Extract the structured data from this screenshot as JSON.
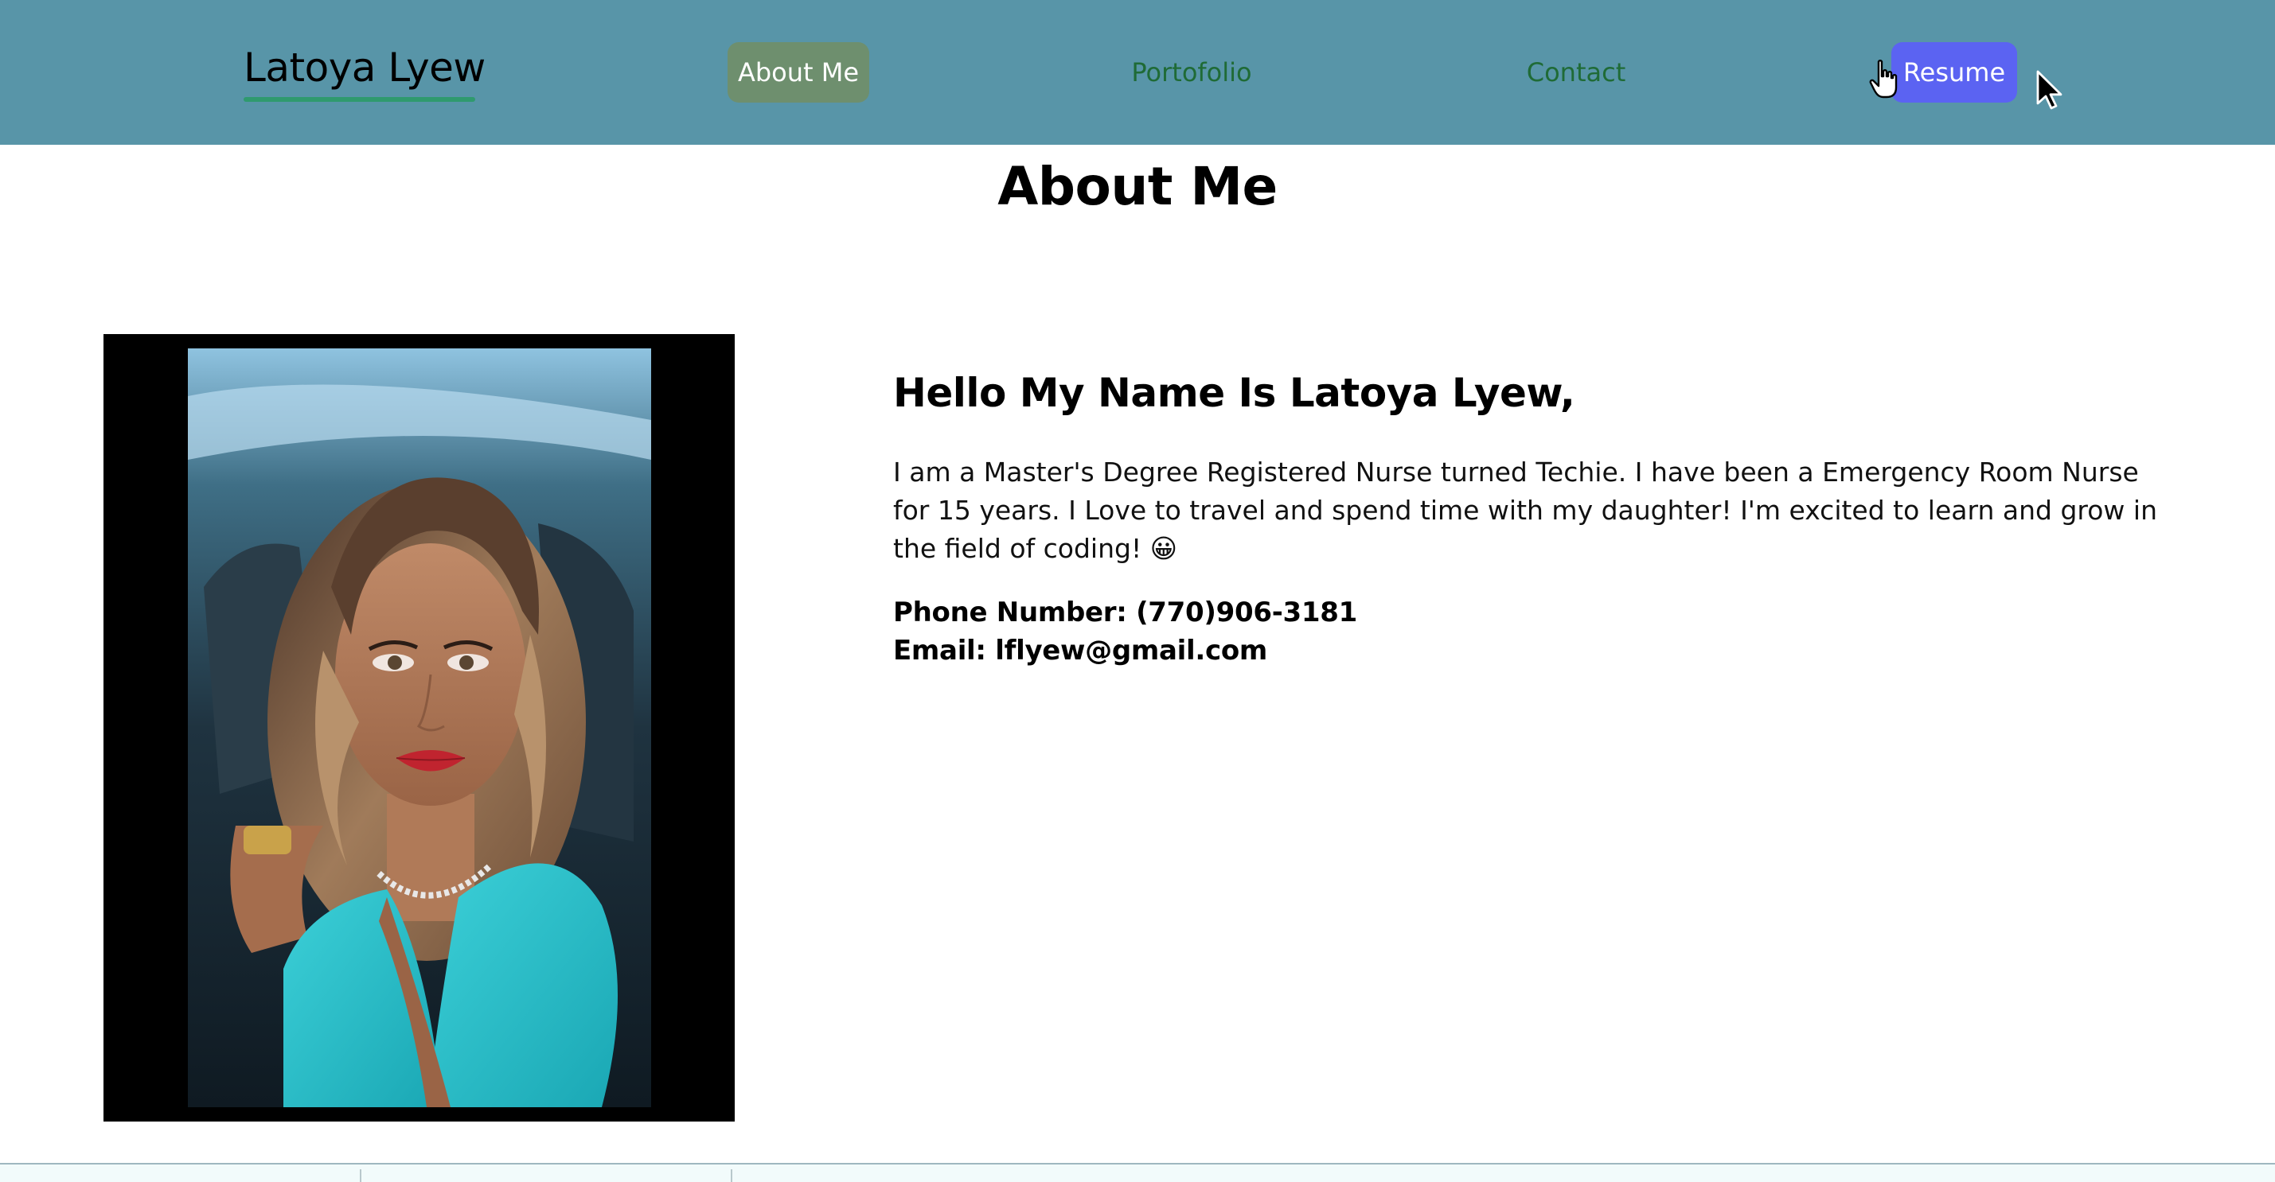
{
  "header": {
    "brand": "Latoya Lyew",
    "nav": {
      "about": "About Me",
      "portfolio": "Portofolio",
      "contact": "Contact",
      "resume": "Resume"
    },
    "active_item": "About Me",
    "colors": {
      "background": "#5895a8",
      "active_bg": "#6e8f6e",
      "link": "#1f6b36",
      "resume_bg": "#5b63f2",
      "brand_underline": "#2f9a6e"
    }
  },
  "main": {
    "title": "About Me",
    "greeting": "Hello My Name Is Latoya Lyew,",
    "bio": "I am a Master's Degree Registered Nurse turned Techie. I have been a Emergency Room Nurse for 15 years. I Love to travel and spend time with my daughter! I'm excited to learn and grow in the field of coding! 😀",
    "phone": "Phone Number: (770)906-3181",
    "email": "Email: lflyew@gmail.com",
    "photo_icon": "profile-photo"
  }
}
